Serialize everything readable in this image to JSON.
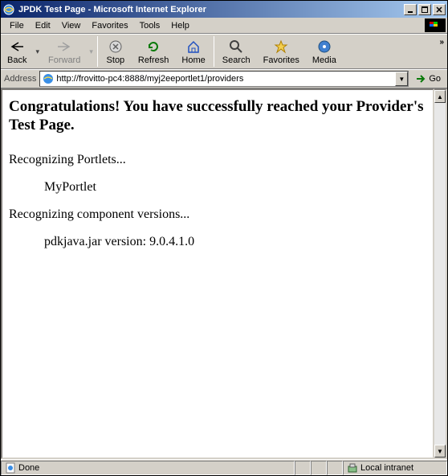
{
  "window": {
    "title": "JPDK Test Page - Microsoft Internet Explorer"
  },
  "menubar": {
    "items": [
      "File",
      "Edit",
      "View",
      "Favorites",
      "Tools",
      "Help"
    ]
  },
  "toolbar": {
    "back": "Back",
    "forward": "Forward",
    "stop": "Stop",
    "refresh": "Refresh",
    "home": "Home",
    "search": "Search",
    "favorites": "Favorites",
    "media": "Media"
  },
  "addressbar": {
    "label": "Address",
    "url": "http://frovitto-pc4:8888/myj2eeportlet1/providers",
    "go": "Go"
  },
  "page": {
    "heading": "Congratulations! You have successfully reached your Provider's Test Page.",
    "line1": "Recognizing Portlets...",
    "portlet": "MyPortlet",
    "line2": "Recognizing component versions...",
    "version": "pdkjava.jar version: 9.0.4.1.0"
  },
  "statusbar": {
    "status": "Done",
    "zone": "Local intranet"
  }
}
